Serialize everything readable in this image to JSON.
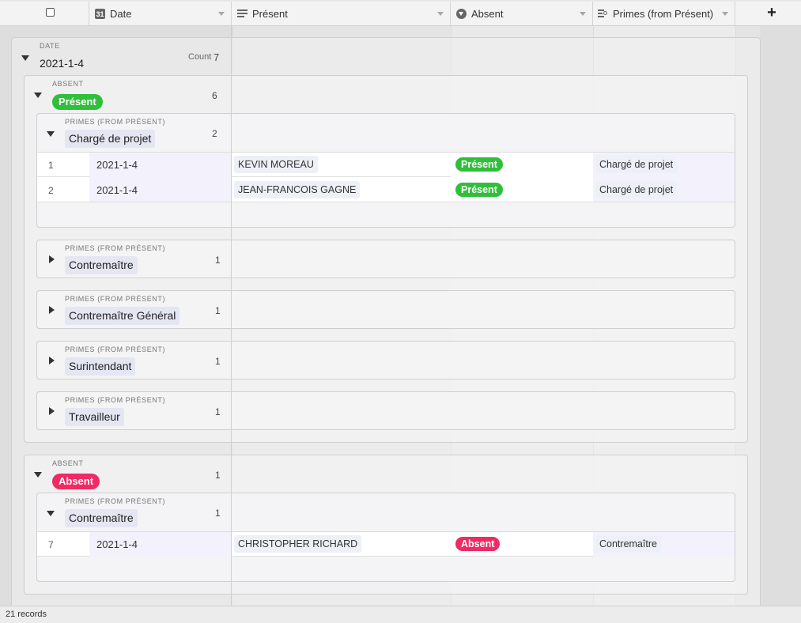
{
  "header": {
    "date_label": "Date",
    "present_label": "Présent",
    "absent_label": "Absent",
    "primes_label": "Primes (from Présent)",
    "calendar_icon_text": "31"
  },
  "group_date": {
    "field_label": "DATE",
    "value": "2021-1-4",
    "count_label": "Count",
    "count": "7"
  },
  "group_present": {
    "field_label": "ABSENT",
    "value": "Présent",
    "count": "6",
    "color": "#2fbf3a"
  },
  "group_absent": {
    "field_label": "ABSENT",
    "value": "Absent",
    "count": "1",
    "color": "#f02a63"
  },
  "primes_field_label": "PRIMES (FROM PRÉSENT)",
  "subgroups_present": [
    {
      "value": "Chargé de projet",
      "count": "2"
    },
    {
      "value": "Contremaître",
      "count": "1"
    },
    {
      "value": "Contremaître Général",
      "count": "1"
    },
    {
      "value": "Surintendant",
      "count": "1"
    },
    {
      "value": "Travailleur",
      "count": "1"
    }
  ],
  "subgroups_absent": [
    {
      "value": "Contremaître",
      "count": "1"
    }
  ],
  "records": [
    {
      "num": "1",
      "date": "2021-1-4",
      "present": "KEVIN MOREAU",
      "absent": "Présent",
      "primes": "Chargé de projet"
    },
    {
      "num": "2",
      "date": "2021-1-4",
      "present": "JEAN-FRANCOIS GAGNE",
      "absent": "Présent",
      "primes": "Chargé de projet"
    },
    {
      "num": "7",
      "date": "2021-1-4",
      "present": "CHRISTOPHER RICHARD",
      "absent": "Absent",
      "primes": "Contremaître"
    }
  ],
  "footer": {
    "records": "21 records"
  },
  "colors": {
    "present": "#2fbf3a",
    "absent": "#f02a63"
  }
}
